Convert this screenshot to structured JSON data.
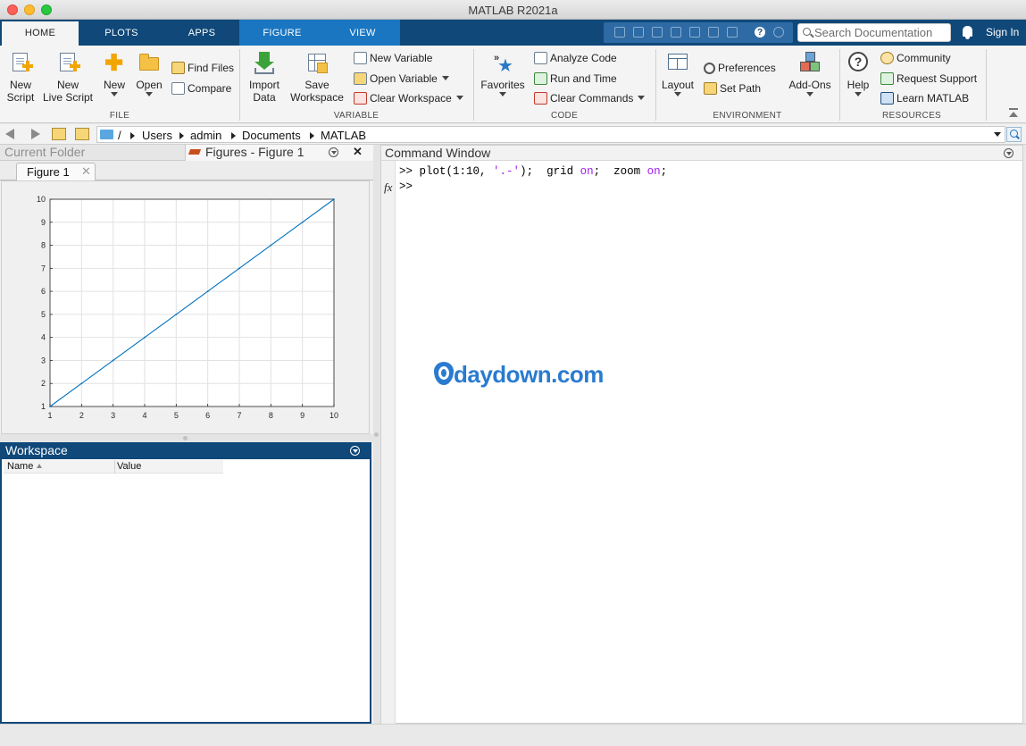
{
  "window": {
    "title": "MATLAB R2021a"
  },
  "tabs": [
    {
      "label": "HOME"
    },
    {
      "label": "PLOTS"
    },
    {
      "label": "APPS"
    },
    {
      "label": "FIGURE"
    },
    {
      "label": "VIEW"
    }
  ],
  "header": {
    "search_placeholder": "Search Documentation",
    "sign_in": "Sign In"
  },
  "ribbon": {
    "file": {
      "group": "FILE",
      "new_script": [
        "New",
        "Script"
      ],
      "new_live_script": [
        "New",
        "Live Script"
      ],
      "new": "New",
      "open": "Open",
      "find_files": "Find Files",
      "compare": "Compare"
    },
    "variable": {
      "group": "VARIABLE",
      "import_data": [
        "Import",
        "Data"
      ],
      "save_workspace": [
        "Save",
        "Workspace"
      ],
      "new_variable": "New Variable",
      "open_variable": "Open Variable",
      "clear_workspace": "Clear Workspace"
    },
    "code": {
      "group": "CODE",
      "favorites": "Favorites",
      "analyze_code": "Analyze Code",
      "run_and_time": "Run and Time",
      "clear_commands": "Clear Commands"
    },
    "environment": {
      "group": "ENVIRONMENT",
      "layout": "Layout",
      "preferences": "Preferences",
      "set_path": "Set Path",
      "add_ons": "Add-Ons"
    },
    "resources": {
      "group": "RESOURCES",
      "help": "Help",
      "community": "Community",
      "request_support": "Request Support",
      "learn_matlab": "Learn MATLAB"
    }
  },
  "path": {
    "root": "/",
    "segments": [
      "Users",
      "admin",
      "Documents",
      "MATLAB"
    ]
  },
  "panels": {
    "current_folder": "Current Folder",
    "figures_title": "Figures - Figure 1",
    "figure_tab": "Figure 1",
    "workspace": "Workspace",
    "workspace_columns": [
      "Name",
      "Value"
    ],
    "command_window": "Command Window"
  },
  "command": {
    "prompt": ">>",
    "history": [
      {
        "prefix": "plot(1:10, ",
        "string": "'.-'",
        "mid": ");  grid ",
        "kw1": "on",
        "mid2": ";  zoom ",
        "kw2": "on",
        "suffix": ";"
      }
    ]
  },
  "watermark": {
    "text": "daydown.com"
  },
  "colors": {
    "tabstrip": "#0f4879",
    "figure_tab": "#1a76c0",
    "plot_line": "#0072bd",
    "keyword": "#a020f0"
  },
  "chart_data": {
    "type": "line",
    "x": [
      1,
      2,
      3,
      4,
      5,
      6,
      7,
      8,
      9,
      10
    ],
    "series": [
      {
        "values": [
          1,
          2,
          3,
          4,
          5,
          6,
          7,
          8,
          9,
          10
        ]
      }
    ],
    "xlim": [
      1,
      10
    ],
    "ylim": [
      1,
      10
    ],
    "xticks": [
      1,
      2,
      3,
      4,
      5,
      6,
      7,
      8,
      9,
      10
    ],
    "yticks": [
      1,
      2,
      3,
      4,
      5,
      6,
      7,
      8,
      9,
      10
    ],
    "grid": true,
    "title": "",
    "xlabel": "",
    "ylabel": ""
  }
}
